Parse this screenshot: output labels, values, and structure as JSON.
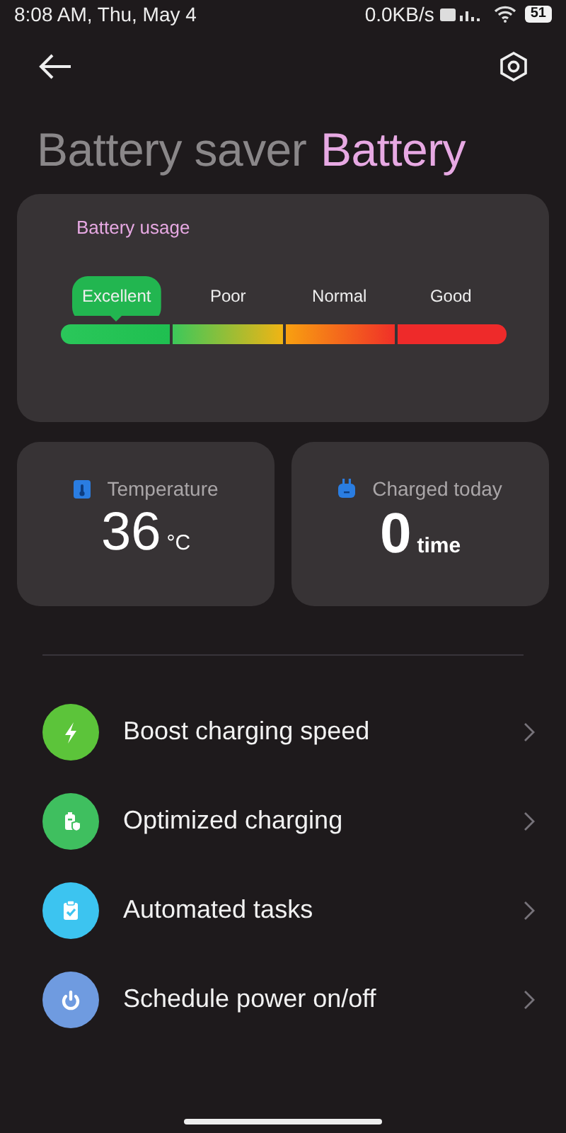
{
  "status_bar": {
    "time": "8:08 AM, Thu, May 4",
    "speed": "0.0KB/s",
    "battery": "51"
  },
  "tabs": [
    {
      "label": "Battery saver",
      "selected": false
    },
    {
      "label": "Battery",
      "selected": true
    }
  ],
  "usage": {
    "title": "Battery usage",
    "levels": [
      {
        "label": "Excellent",
        "selected": true
      },
      {
        "label": "Poor",
        "selected": false
      },
      {
        "label": "Normal",
        "selected": false
      },
      {
        "label": "Good",
        "selected": false
      }
    ]
  },
  "stats": [
    {
      "kind": "thermometer",
      "label": "Temperature",
      "value": "36",
      "unit": "°C"
    },
    {
      "kind": "plug",
      "label": "Charged today",
      "value": "0",
      "unit": "time"
    }
  ],
  "menu": [
    {
      "kind": "bolt",
      "color": "#5cc43a",
      "label": "Boost charging speed"
    },
    {
      "kind": "battery",
      "color": "#3fbf5f",
      "label": "Optimized charging"
    },
    {
      "kind": "clipboard",
      "color": "#3cc4f0",
      "label": "Automated tasks"
    },
    {
      "kind": "power",
      "color": "#6f9be0",
      "label": "Schedule power on/off"
    }
  ]
}
